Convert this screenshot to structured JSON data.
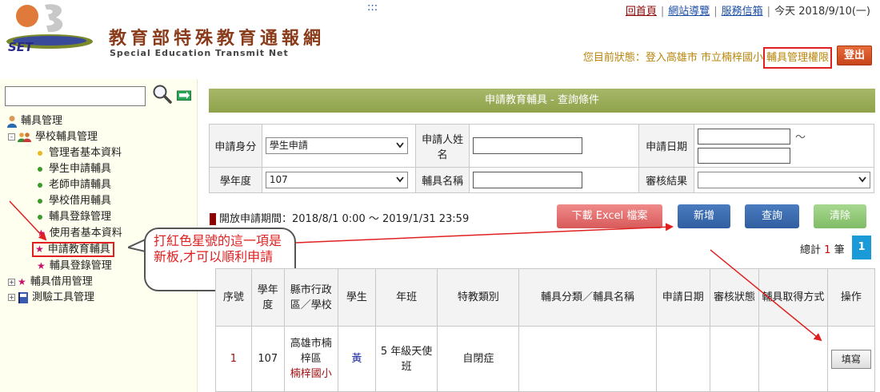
{
  "header": {
    "logo_text": "SET",
    "site_title": "教育部特殊教育通報網",
    "site_subtitle": "Special Education Transmit Net",
    "dots": ":::",
    "links": {
      "home": "回首頁",
      "sitemap": "網站導覽",
      "mailbox": "服務信箱"
    },
    "today": "今天 2018/9/10(一)",
    "status_prefix": "您目前狀態：登入高雄市 市立楠梓國小",
    "status_role": "輔具管理權限",
    "logout": "登出"
  },
  "sidebar": {
    "search_value": "",
    "tree": [
      {
        "label": "輔具管理",
        "icon": "user-icon"
      },
      {
        "label": "學校輔具管理",
        "icon": "group-icon",
        "expander": "-"
      },
      {
        "label": "管理者基本資料",
        "icon": "bullet-yellow"
      },
      {
        "label": "學生申請輔具",
        "icon": "bullet-green"
      },
      {
        "label": "老師申請輔具",
        "icon": "bullet-green"
      },
      {
        "label": "學校借用輔具",
        "icon": "bullet-green"
      },
      {
        "label": "輔具登錄管理",
        "icon": "bullet-green"
      },
      {
        "label": "使用者基本資料",
        "icon": "star-icon"
      },
      {
        "label": "申請教育輔具",
        "icon": "star-icon"
      },
      {
        "label": "輔具登錄管理",
        "icon": "star-icon"
      },
      {
        "label": "輔具借用管理",
        "icon": "star-icon",
        "expander": "+"
      },
      {
        "label": "測驗工具管理",
        "icon": "book-icon",
        "expander": "+"
      }
    ]
  },
  "callout": "打紅色星號的這一項是新板,才可以順利申請",
  "main": {
    "title": "申請教育輔具 - 查詢條件",
    "query": {
      "applicant_type_label": "申請身分",
      "applicant_type_value": "學生申請",
      "applicant_name_label": "申請人姓名",
      "apply_date_label": "申請日期",
      "date_sep": "～",
      "school_year_label": "學年度",
      "school_year_value": "107",
      "device_name_label": "輔具名稱",
      "review_label": "審核結果",
      "review_value": ""
    },
    "period": "開放申請期間：2018/8/1 0:00 ～ 2019/1/31 23:59",
    "buttons": {
      "excel": "下載 Excel 檔案",
      "add": "新增",
      "query": "查詢",
      "clear": "清除"
    },
    "total_prefix": "總計",
    "total_count": "1",
    "total_suffix": "筆",
    "page": "1",
    "columns": [
      "序號",
      "學年度",
      "縣市行政區／學校",
      "學生",
      "年班",
      "特教類別",
      "輔具分類／輔具名稱",
      "申請日期",
      "審核狀態",
      "輔具取得方式",
      "操作"
    ],
    "row": {
      "seq": "1",
      "year": "107",
      "district": "高雄市楠梓區",
      "school": "楠梓國小",
      "student": "黃",
      "class": "5 年級天使班",
      "category": "自閉症",
      "device": "",
      "date": "",
      "review": "",
      "method": "",
      "action": "填寫"
    }
  },
  "colors": {
    "accent_red": "#e02020",
    "title_bar": "#98aa56",
    "brand": "#8a3b1a"
  }
}
